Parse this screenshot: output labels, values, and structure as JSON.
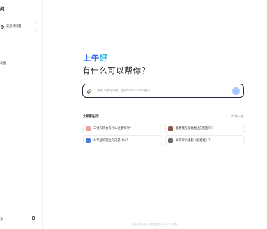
{
  "sidebar": {
    "title": "问",
    "new_chat_label": "开启新问题",
    "nav_label": "读懂",
    "bottom_label": "录"
  },
  "main": {
    "greeting_part1": "上午",
    "greeting_part2": "好",
    "subtitle": "有什么可以帮你？",
    "input_placeholder": "请输入你的问题，使用Shift+Enter换行",
    "send_icon": "↑",
    "faq_title": "大家都在问：",
    "refresh_label": "换一批",
    "refresh_icon": "⇄",
    "questions": [
      {
        "label": "三伏天饮食有什么注意事项？",
        "avatar_color": "#e8a0a0"
      },
      {
        "label": "能教我在家做图上的甜品吗？",
        "avatar_color": "#8a5a44"
      },
      {
        "label": "AI专业的就业方向是什么？",
        "avatar_color": "#4a7bd8"
      },
      {
        "label": "如何评价电影《抓娃娃》？",
        "avatar_color": "#6b6b6b"
      }
    ],
    "footer": "内容由AI生成，请仔细甄别  © 2024 版权"
  },
  "colors": {
    "accent": "#2f6bff",
    "accent_light": "#22b4e6",
    "send_button": "#a9c6ff"
  }
}
